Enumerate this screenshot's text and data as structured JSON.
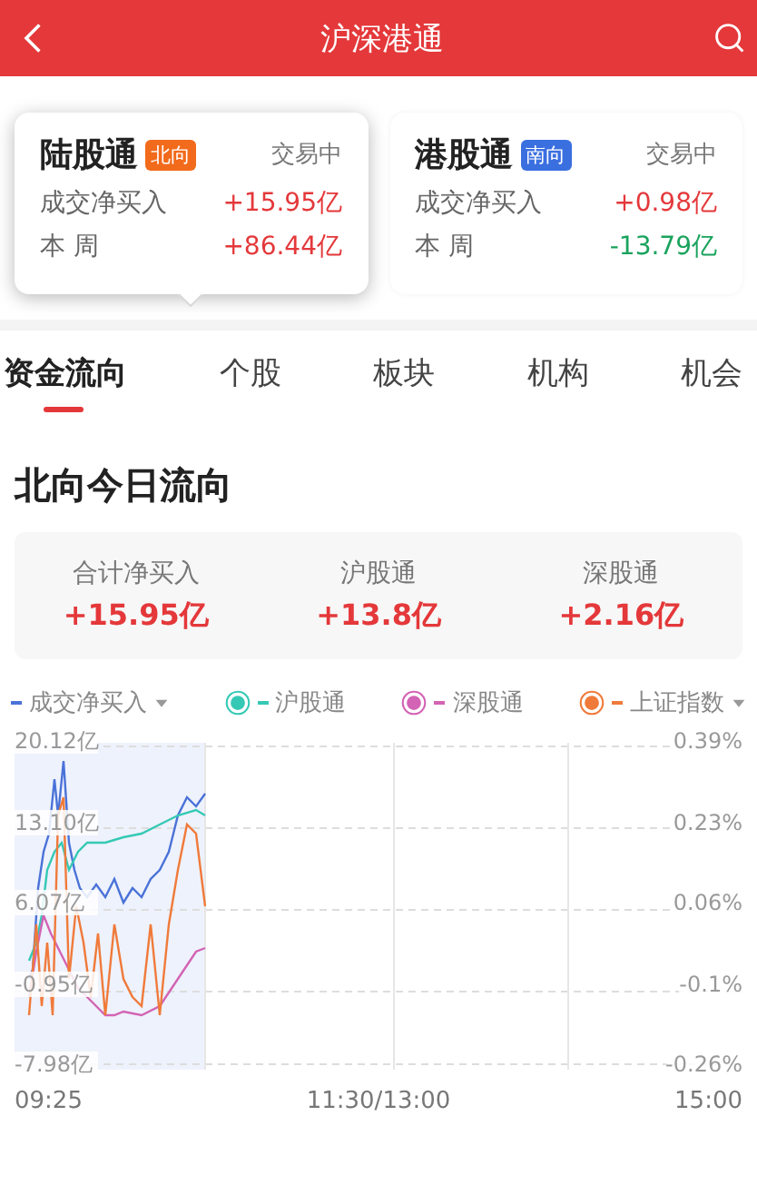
{
  "header": {
    "title": "沪深港通"
  },
  "cards": [
    {
      "name": "陆股通",
      "tag": {
        "label": "北向",
        "color": "#f26a1b"
      },
      "status": "交易中",
      "selected": true,
      "rows": [
        {
          "label": "成交净买入",
          "value": "+15.95亿",
          "color": "#e4383a"
        },
        {
          "label": "本 周",
          "value": "+86.44亿",
          "color": "#e4383a"
        }
      ]
    },
    {
      "name": "港股通",
      "tag": {
        "label": "南向",
        "color": "#3a6fe0"
      },
      "status": "交易中",
      "selected": false,
      "rows": [
        {
          "label": "成交净买入",
          "value": "+0.98亿",
          "color": "#e4383a"
        },
        {
          "label": "本 周",
          "value": "-13.79亿",
          "color": "#1aa35d"
        }
      ]
    }
  ],
  "tabs": [
    {
      "label": "资金流向",
      "selected": true
    },
    {
      "label": "个股",
      "selected": false
    },
    {
      "label": "板块",
      "selected": false
    },
    {
      "label": "机构",
      "selected": false
    },
    {
      "label": "机会",
      "selected": false
    }
  ],
  "section_title": "北向今日流向",
  "summary": [
    {
      "label": "合计净买入",
      "value": "+15.95亿"
    },
    {
      "label": "沪股通",
      "value": "+13.8亿"
    },
    {
      "label": "深股通",
      "value": "+2.16亿"
    }
  ],
  "legend": [
    {
      "label": "成交净买入",
      "color": "#4a72d8",
      "dropdown": true,
      "dot": false
    },
    {
      "label": "沪股通",
      "color": "#35c9b5",
      "dropdown": false,
      "dot": true
    },
    {
      "label": "深股通",
      "color": "#d363b4",
      "dropdown": false,
      "dot": true
    },
    {
      "label": "上证指数",
      "color": "#f07a3a",
      "dropdown": true,
      "dot": true
    }
  ],
  "chart": {
    "left_ticks": [
      "20.12亿",
      "13.10亿",
      "6.07亿",
      "-0.95亿",
      "-7.98亿"
    ],
    "right_ticks": [
      "0.39%",
      "0.23%",
      "0.06%",
      "-0.1%",
      "-0.26%"
    ],
    "x_labels": [
      "09:25",
      "11:30/13:00",
      "15:00"
    ]
  }
}
